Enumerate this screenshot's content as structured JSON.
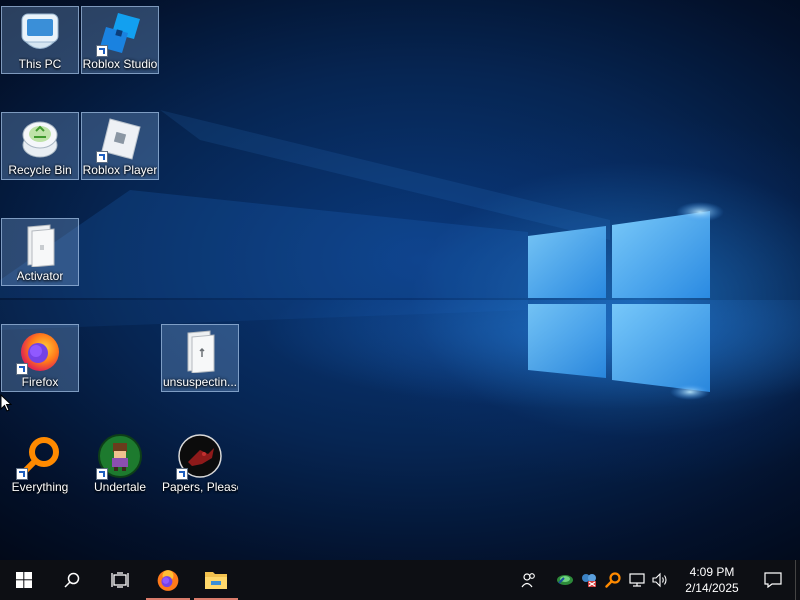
{
  "desktop": {
    "icons": [
      {
        "name": "this-pc",
        "label": "This PC",
        "icon": "this-pc-icon",
        "shortcut": false
      },
      {
        "name": "roblox-studio",
        "label": "Roblox Studio",
        "icon": "roblox-studio-icon",
        "shortcut": true
      },
      {
        "name": "recycle-bin",
        "label": "Recycle Bin",
        "icon": "recycle-bin-icon",
        "shortcut": false
      },
      {
        "name": "roblox-player",
        "label": "Roblox Player",
        "icon": "roblox-player-icon",
        "shortcut": true
      },
      {
        "name": "activator",
        "label": "Activator",
        "icon": "folder-icon",
        "shortcut": false
      },
      {
        "name": "firefox",
        "label": "Firefox",
        "icon": "firefox-icon",
        "shortcut": true
      },
      {
        "name": "unsuspecting",
        "label": "unsuspectin...",
        "icon": "folder-icon",
        "shortcut": false
      },
      {
        "name": "everything",
        "label": "Everything",
        "icon": "everything-search-icon",
        "shortcut": true
      },
      {
        "name": "undertale",
        "label": "Undertale",
        "icon": "undertale-icon",
        "shortcut": true
      },
      {
        "name": "papers-please",
        "label": "Papers, Please",
        "icon": "papers-please-icon",
        "shortcut": true
      }
    ]
  },
  "taskbar": {
    "start": "windows-start-icon",
    "search": "search-icon",
    "task_view": "task-view-icon",
    "pinned": [
      {
        "name": "firefox",
        "icon": "firefox-icon",
        "running": true
      },
      {
        "name": "file-explorer",
        "icon": "folder-icon",
        "running": true
      }
    ],
    "tray": [
      "people-icon",
      "network-sync-icon",
      "app-tray-icon",
      "everything-search-icon",
      "network-icon",
      "volume-icon"
    ],
    "clock": {
      "time": "4:09 PM",
      "date": "2/14/2025"
    },
    "notification": "action-center-icon"
  },
  "colors": {
    "taskbar": "#0d0f14",
    "accent_running": "#d97b6b",
    "wallpaper": "#0a3a7e"
  }
}
